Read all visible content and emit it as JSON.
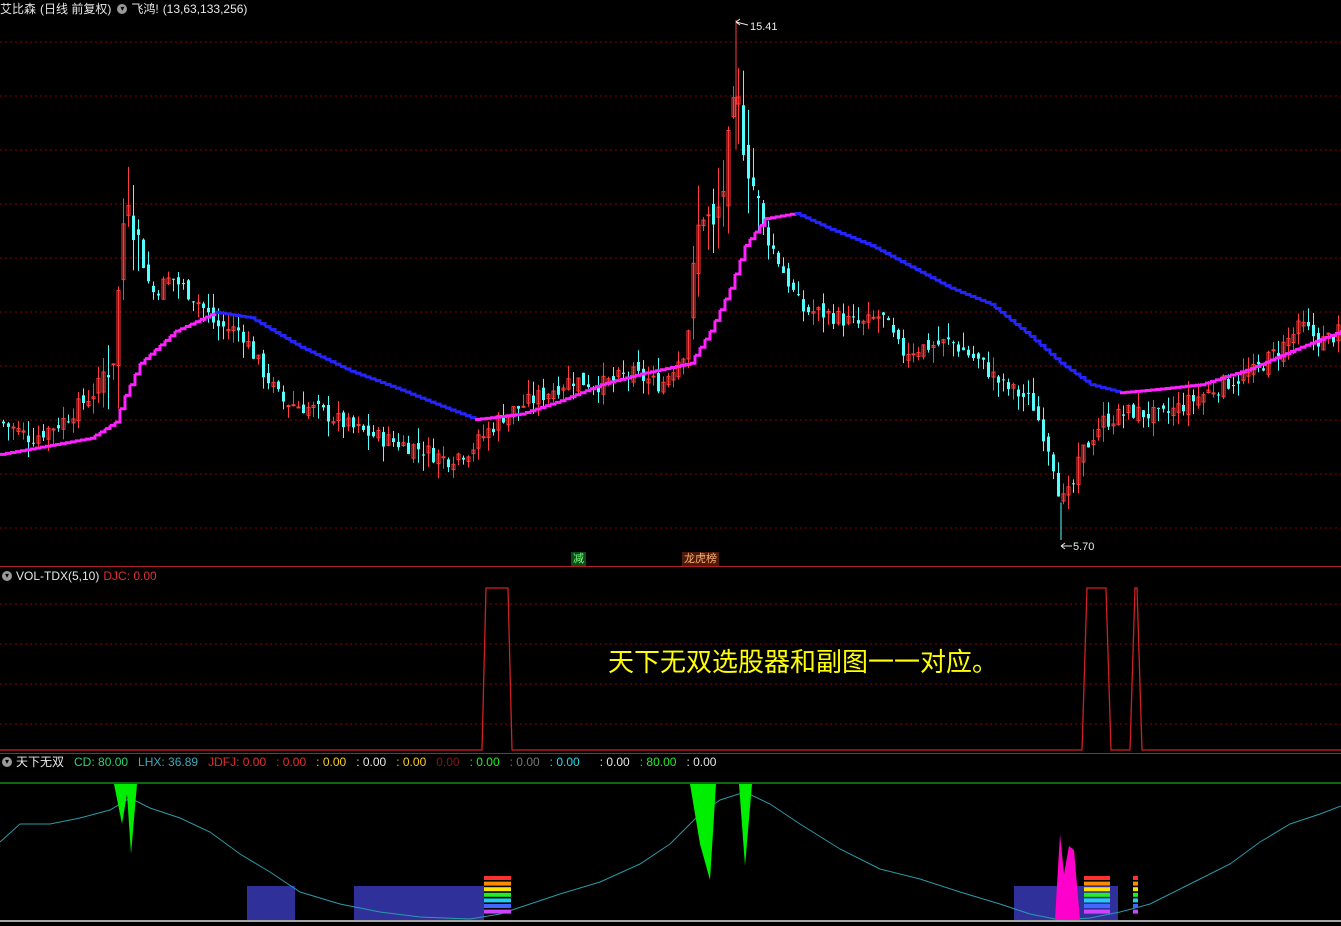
{
  "main_header": {
    "stock_name": "艾比森",
    "period": "(日线 前复权)",
    "indicator_name": "飞鸿!",
    "indicator_params": "(13,63,133,256)"
  },
  "vol_header": {
    "name": "VOL-TDX(5,10)",
    "djc_label": "DJC: 0.00"
  },
  "ind_header": {
    "name": "天下无双",
    "items": [
      {
        "text": "CD: 80.00",
        "color": "#2dd36f"
      },
      {
        "text": "LHX: 36.89",
        "color": "#3fa9b8"
      },
      {
        "text": "JDFJ: 0.00",
        "color": "#e03030"
      },
      {
        "text": ": 0.00",
        "color": "#e03030"
      },
      {
        "text": ": 0.00",
        "color": "#ffd21e"
      },
      {
        "text": ": 0.00",
        "color": "#e8e8e8"
      },
      {
        "text": ": 0.00",
        "color": "#ffd21e"
      },
      {
        "text": "0.00",
        "color": "#7a1a1a"
      },
      {
        "text": ": 0.00",
        "color": "#22ee22"
      },
      {
        "text": ": 0.00",
        "color": "#777777"
      },
      {
        "text": ": 0.00",
        "color": "#22ddee"
      },
      {
        "text": "",
        "color": "#202060"
      },
      {
        "text": ": 0.00",
        "color": "#e8e8e8"
      },
      {
        "text": ": 80.00",
        "color": "#22ee22"
      },
      {
        "text": ": 0.00",
        "color": "#e8e8e8"
      }
    ]
  },
  "annotations": {
    "high_label": "15.41",
    "low_label": "5.70",
    "badge_1": "减",
    "badge_2": "龙虎榜"
  },
  "overlay_text": "天下无双选股器和副图一一对应。",
  "colors": {
    "up_candle": "#ff3b3b",
    "down_candle": "#54ffff",
    "ma_up": "#ff22ff",
    "ma_down": "#2424ff",
    "grid": "#8b0000",
    "lhx_line": "#2a9aaa",
    "green_spike": "#00ee00",
    "blue_block": "#30309a",
    "magenta_spike": "#ff00cc"
  },
  "chart_data": {
    "type": "candlestick",
    "price_high": 15.41,
    "price_low": 5.7
  }
}
